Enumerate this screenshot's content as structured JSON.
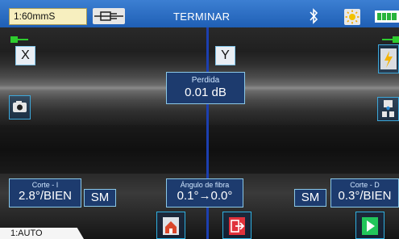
{
  "header": {
    "mode": "1:60mmS",
    "title": "TERMINAR",
    "icons": [
      "cable-icon",
      "bluetooth-icon",
      "sun-icon",
      "battery-icon"
    ]
  },
  "axes": {
    "x_label": "X",
    "y_label": "Y"
  },
  "loss": {
    "label": "Perdida",
    "value": "0.01 dB"
  },
  "cut_left": {
    "label": "Corte - I",
    "value": "2.8°/BIEN"
  },
  "cut_right": {
    "label": "Corte - D",
    "value": "0.3°/BIEN"
  },
  "fiber_angle": {
    "label": "Ángulo de fibra",
    "value": "0.1°→0.0°"
  },
  "fiber_type": {
    "left": "SM",
    "right": "SM"
  },
  "footer": {
    "program": "1:AUTO"
  },
  "colors": {
    "header": "#2f6fc4",
    "accent_line": "#1c3fb0",
    "panel": "#1d3b6e",
    "panel_border": "#8ac7e6",
    "marker_green": "#2ecc2e",
    "play_green": "#22c65a",
    "exit_red": "#e0323c",
    "mode_box": "#f7efbf"
  }
}
